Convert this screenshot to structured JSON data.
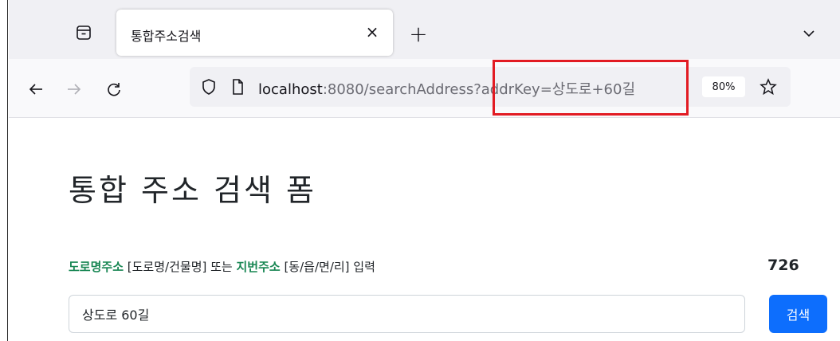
{
  "browser": {
    "tab_title": "통합주소검색",
    "tab_close_glyph": "×",
    "new_tab_glyph": "+",
    "url_host": "localhost",
    "url_rest": ":8080/searchAddress?addrKey=상도로+60길",
    "zoom_level": "80%"
  },
  "page": {
    "title": "통합 주소 검색 폼",
    "instruction": {
      "part1": "도로명주소",
      "part2": " [도로명/건물명] 또는 ",
      "part3": "지번주소",
      "part4": " [동/읍/면/리] 입력"
    },
    "result_count": "726",
    "search_value": "상도로 60길",
    "search_button_label": "검색"
  },
  "colors": {
    "highlight": "#e21b23",
    "accent_green": "#198754",
    "primary_blue": "#0d6efd"
  },
  "icons": [
    "tab-list-icon",
    "close-icon",
    "plus-icon",
    "chevron-down-icon",
    "back-arrow-icon",
    "forward-arrow-icon",
    "reload-icon",
    "shield-icon",
    "page-icon",
    "star-icon"
  ]
}
